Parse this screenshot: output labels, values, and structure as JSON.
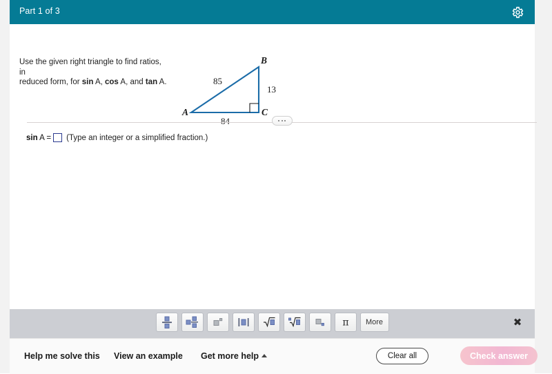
{
  "header": {
    "title": "Part 1 of 3",
    "settings_icon": "gear-icon",
    "bg_color": "#057b95"
  },
  "question": {
    "line1": "Use the given right triangle to find ratios, in",
    "line2_pre": "reduced form, for ",
    "bold1": "sin",
    "mid1": " A, ",
    "bold2": "cos",
    "mid2": " A, and ",
    "bold3": "tan",
    "mid3": " A."
  },
  "figure": {
    "type": "right-triangle",
    "vertex_a": "A",
    "vertex_b": "B",
    "vertex_c": "C",
    "side_ab": "85",
    "side_bc": "13",
    "side_ac": "84",
    "right_angle_at": "C",
    "stroke_color": "#1b6ca8"
  },
  "divider": {
    "dots": "..."
  },
  "answer": {
    "label_bold": "sin",
    "label_rest": " A =",
    "input_value": "",
    "input_placeholder": "",
    "hint": "(Type an integer or a simplified fraction.)"
  },
  "palette": {
    "buttons": [
      {
        "name": "fraction-icon",
        "label": "fraction"
      },
      {
        "name": "mixed-number-icon",
        "label": "mixed number"
      },
      {
        "name": "exponent-icon",
        "label": "exponent"
      },
      {
        "name": "absolute-value-icon",
        "label": "absolute value"
      },
      {
        "name": "square-root-icon",
        "label": "square root"
      },
      {
        "name": "nth-root-icon",
        "label": "nth root"
      },
      {
        "name": "subscript-icon",
        "label": "subscript"
      },
      {
        "name": "pi-icon",
        "label": "π"
      }
    ],
    "more_label": "More",
    "close_icon": "✖"
  },
  "footer": {
    "help_me_solve_this": "Help me solve this",
    "view_an_example": "View an example",
    "get_more_help": "Get more help",
    "clear_all": "Clear all",
    "check_answer": "Check answer"
  }
}
